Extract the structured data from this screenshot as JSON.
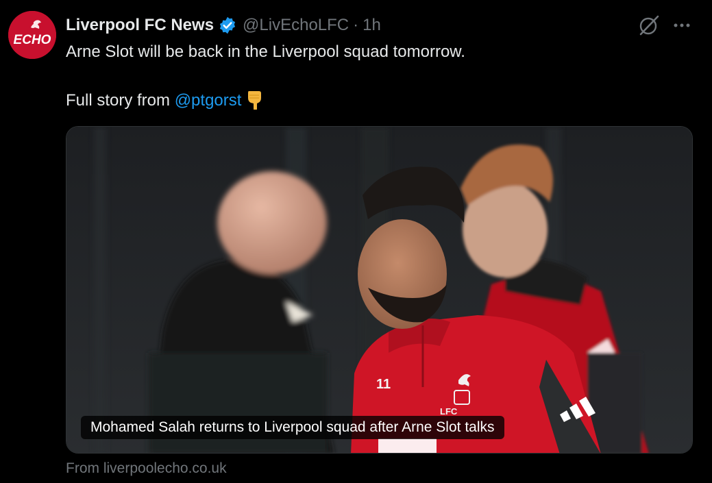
{
  "tweet": {
    "avatar_text": "ECHO",
    "display_name": "Liverpool FC News",
    "verified_icon": "verified-badge-icon",
    "handle": "@LivEchoLFC",
    "separator": "·",
    "time": "1h",
    "text_line1": "Arne Slot will be back in the Liverpool squad tomorrow.",
    "text_line2_prefix": "Full story from",
    "mention": "@ptgorst",
    "emoji": "👇"
  },
  "link_card": {
    "headline": "Mohamed Salah returns to Liverpool squad after Arne Slot talks",
    "source": "From liverpoolecho.co.uk",
    "shirt_number": "11",
    "crest_text": "LFC"
  },
  "icons": {
    "grok": "grok-icon",
    "more": "more-icon"
  },
  "colors": {
    "background": "#000000",
    "text_primary": "#e7e9ea",
    "text_secondary": "#71767b",
    "link": "#1d9bf0",
    "verified": "#1d9bf0",
    "brand_red": "#c8102e"
  }
}
